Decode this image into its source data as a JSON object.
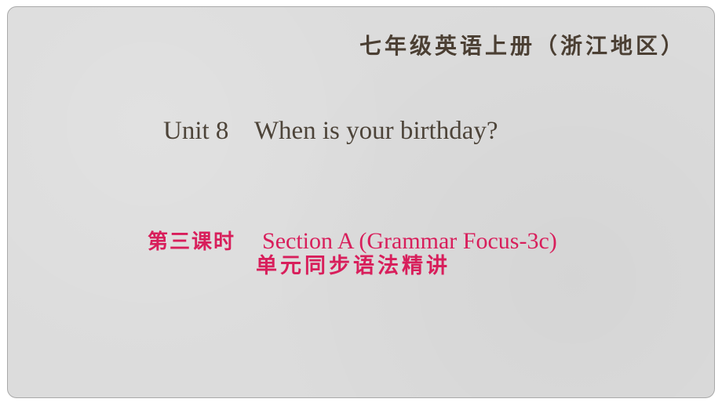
{
  "slide": {
    "series_title": "七年级英语上册（浙江地区）",
    "unit_title": "Unit 8    When is your birthday?",
    "lesson": {
      "period": "第三课时",
      "section": "Section A (Grammar Focus-3c)"
    },
    "subtitle": "单元同步语法精讲",
    "colors": {
      "background": "#dcdcdc",
      "title_text": "#4b3f33",
      "accent": "#d81e5b"
    }
  }
}
